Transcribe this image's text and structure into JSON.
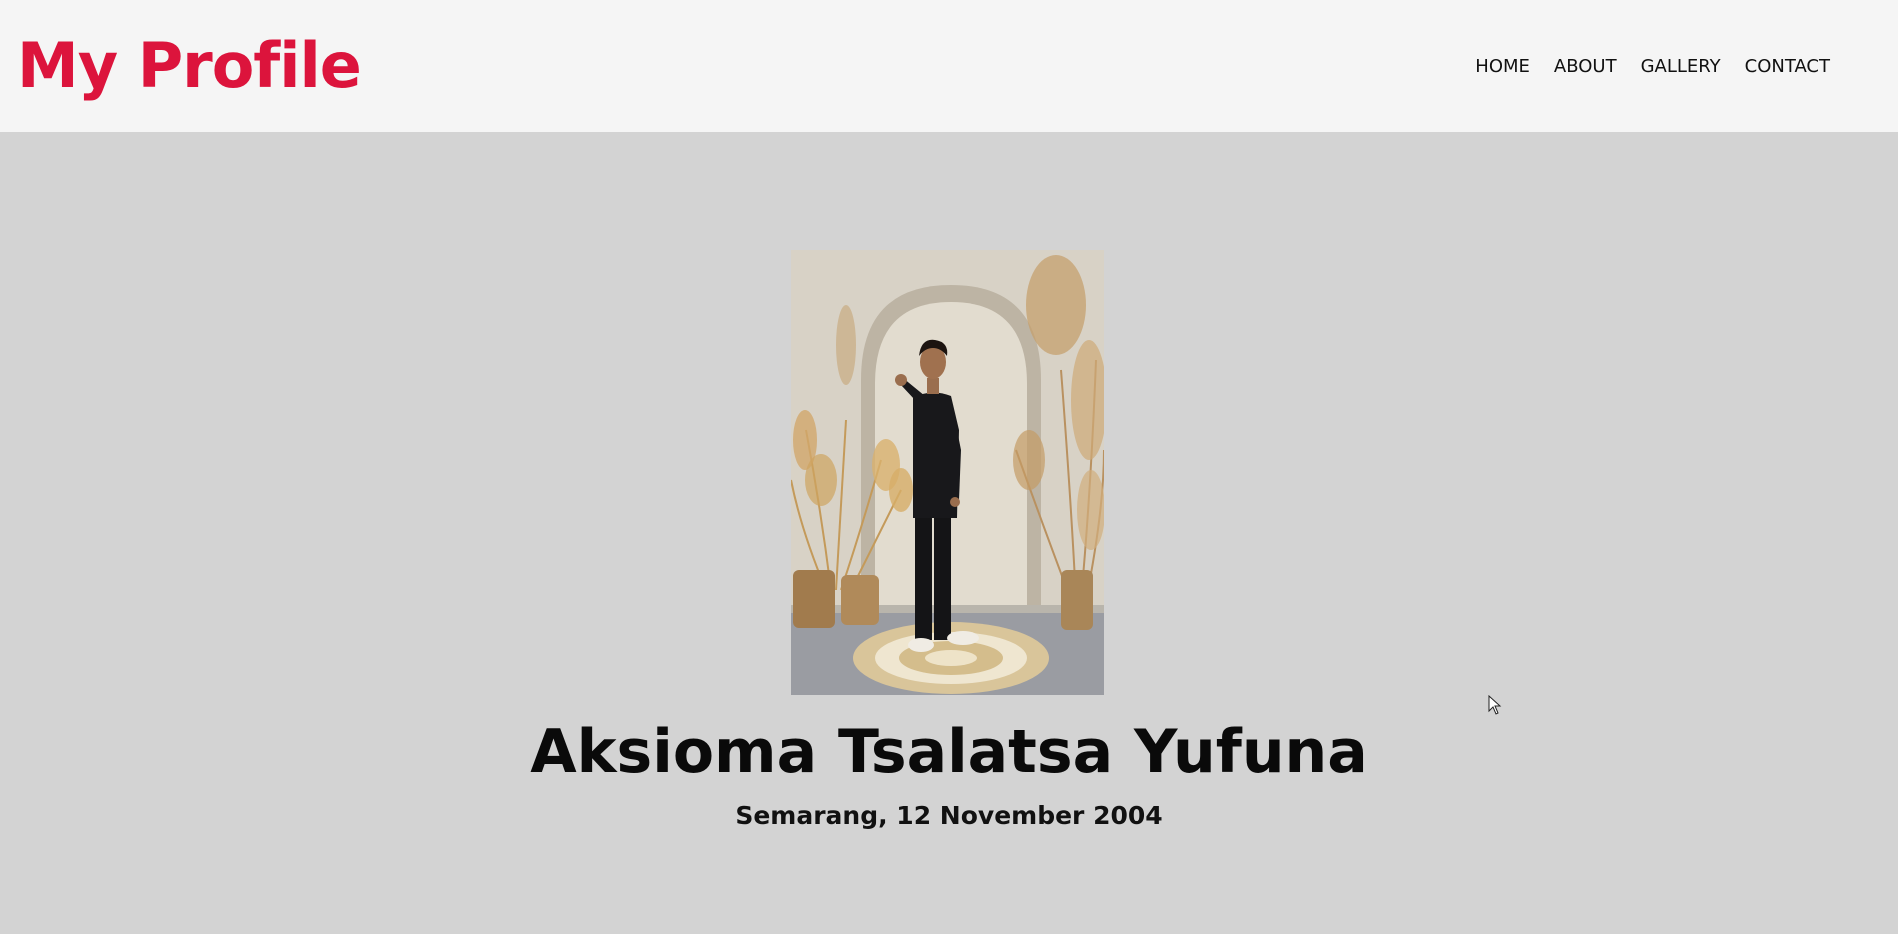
{
  "header": {
    "logo_text": "My Profile",
    "logo_color": "#dc143c",
    "background": "#f5f5f5"
  },
  "nav": {
    "items": [
      {
        "label": "HOME"
      },
      {
        "label": "ABOUT"
      },
      {
        "label": "GALLERY"
      },
      {
        "label": "CONTACT"
      }
    ]
  },
  "hero": {
    "background": "#d3d3d3",
    "photo_icon": "profile-photo",
    "name": "Aksioma Tsalatsa Yufuna",
    "birth_info": "Semarang, 12 November 2004"
  }
}
